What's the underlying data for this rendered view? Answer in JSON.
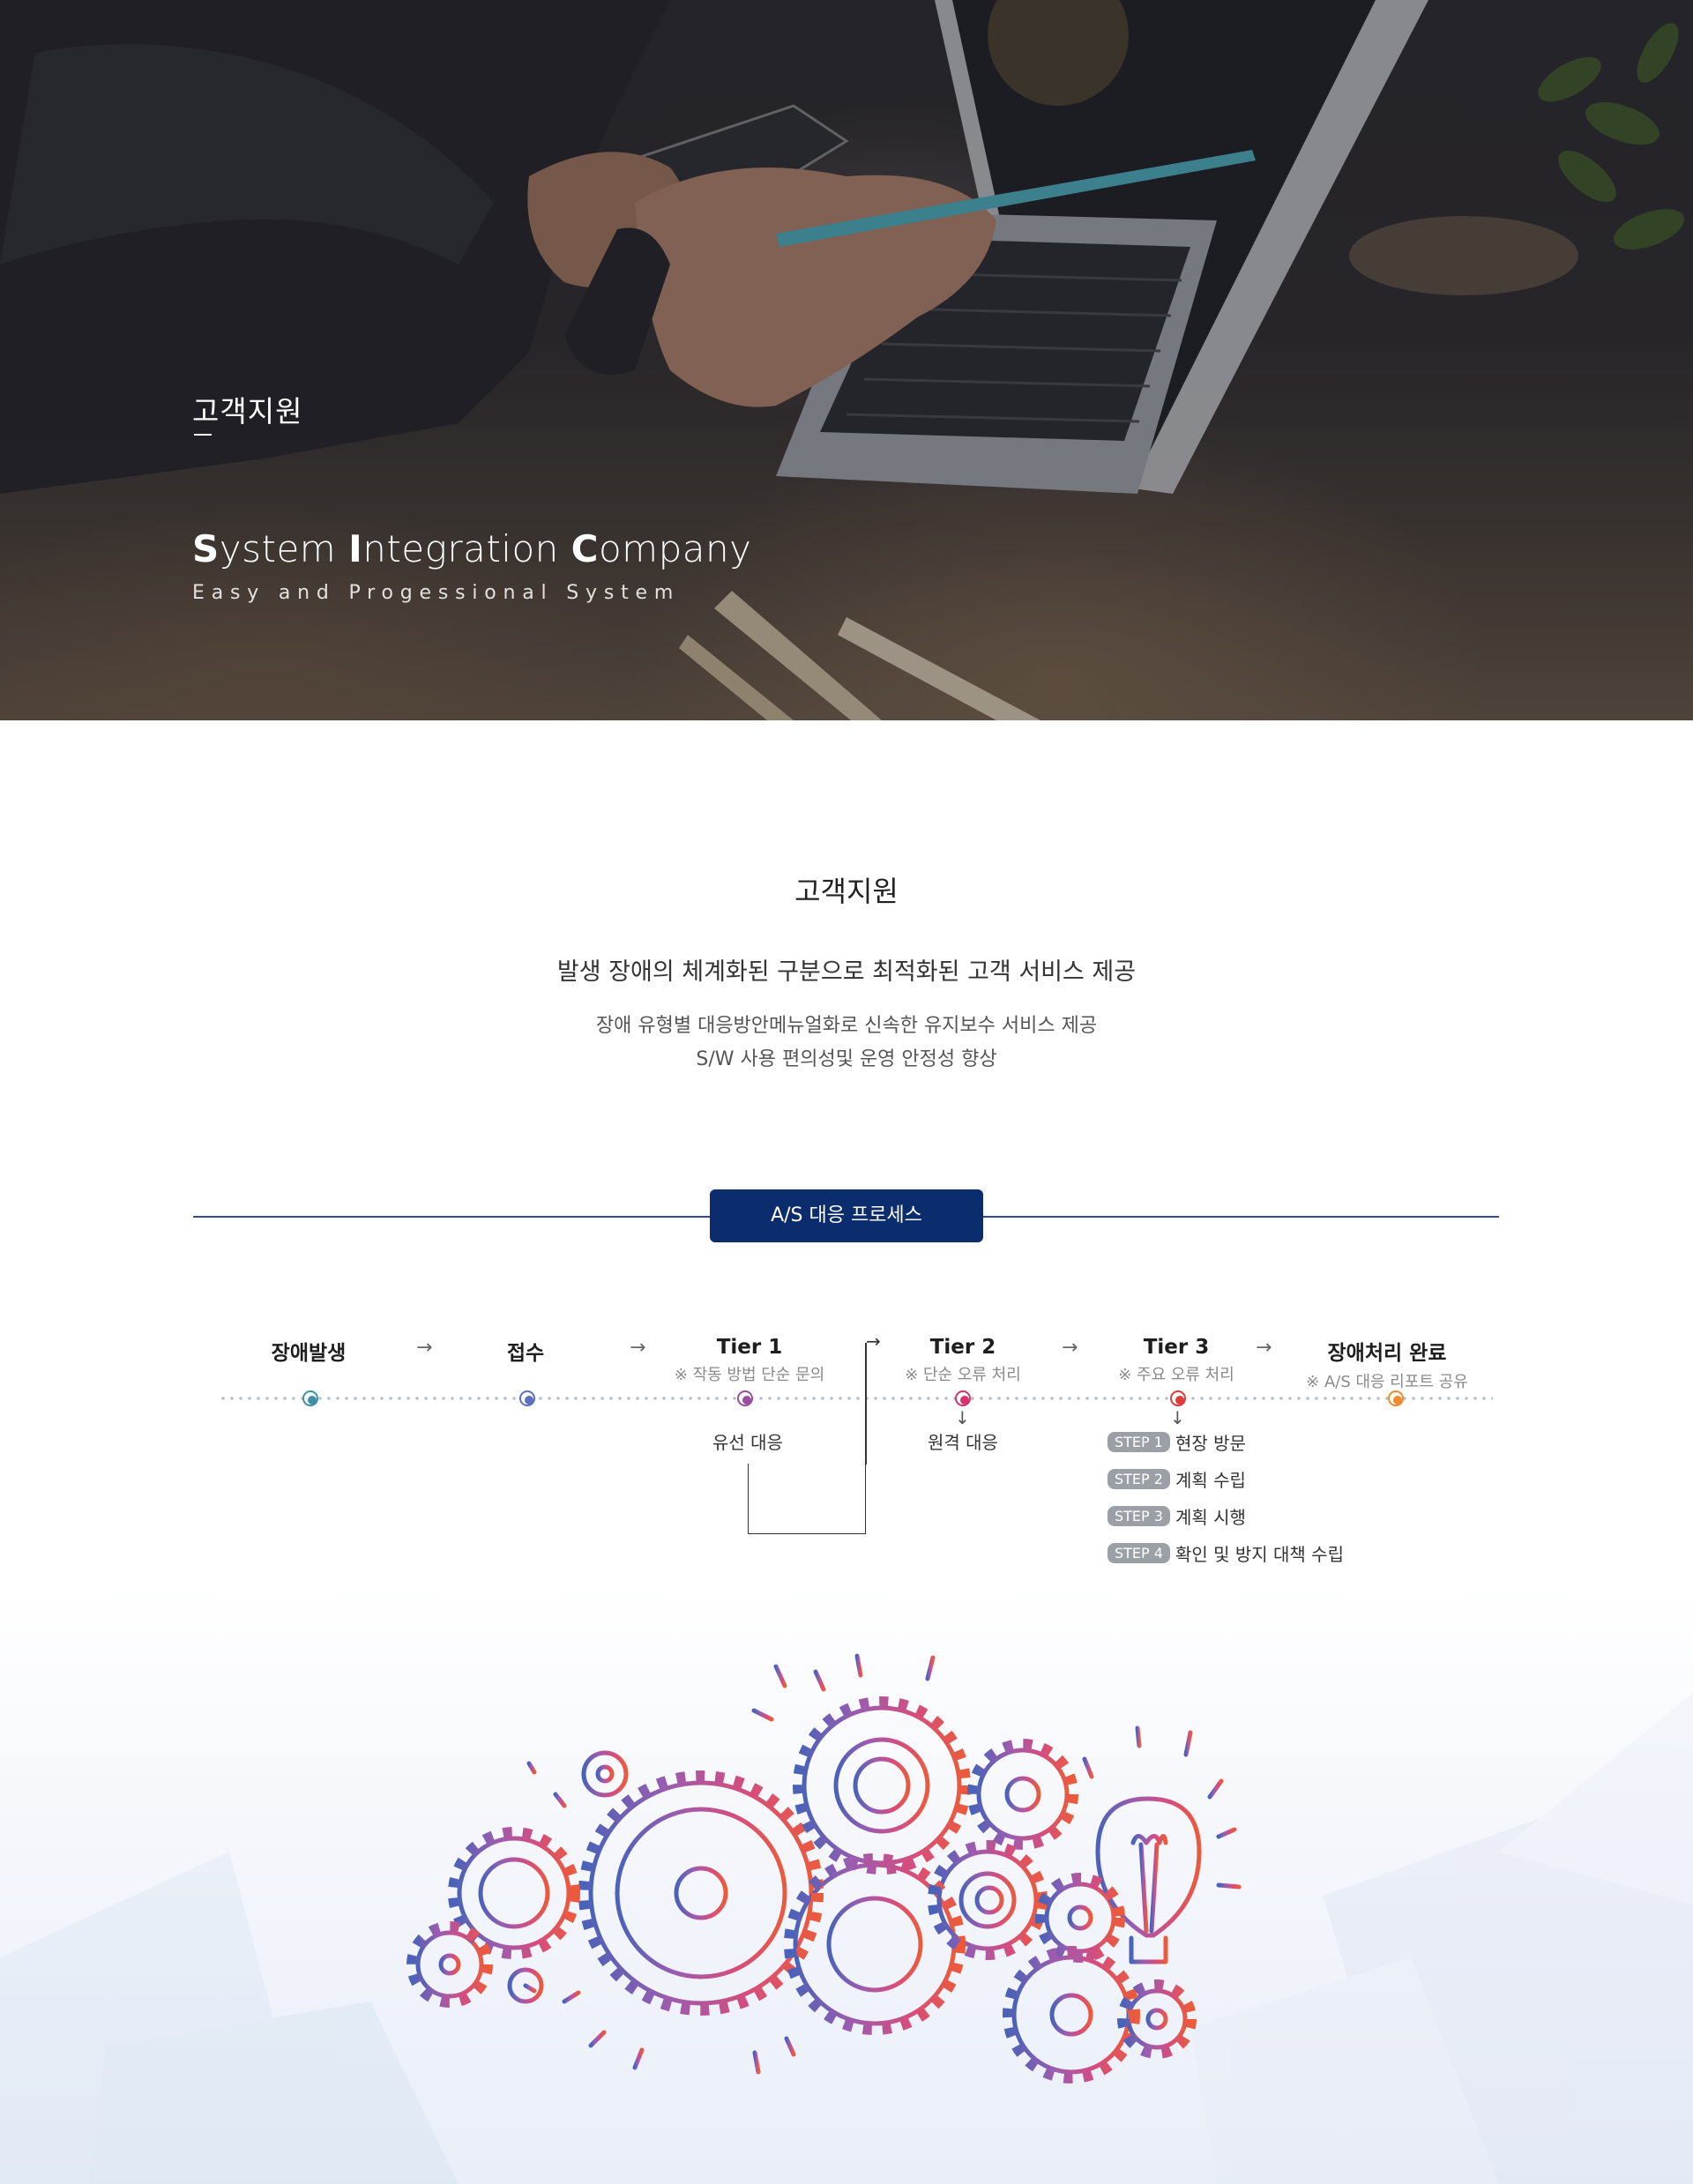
{
  "hero": {
    "title": "고객지원",
    "company_parts": [
      {
        "initial": "S",
        "rest": "ystem "
      },
      {
        "initial": "I",
        "rest": "ntegration "
      },
      {
        "initial": "C",
        "rest": "ompany"
      }
    ],
    "subtitle": "Easy and Progessional System"
  },
  "intro": {
    "title": "고객지원",
    "headline": "발생 장애의 체계화된 구분으로 최적화된 고객 서비스 제공",
    "lines": [
      "장애 유형별 대응방안메뉴얼화로 신속한 유지보수 서비스 제공",
      "S/W 사용 편의성및 운영 안정성 향상"
    ]
  },
  "process": {
    "badge": "A/S 대응 프로세스",
    "stages": [
      {
        "title": "장애발생",
        "note": "",
        "color": "#3d8fa8"
      },
      {
        "title": "접수",
        "note": "",
        "color": "#5a6fc0"
      },
      {
        "title": "Tier 1",
        "note": "※ 작동 방법 단순 문의",
        "color": "#9a4f9e"
      },
      {
        "title": "Tier 2",
        "note": "※ 단순 오류 처리",
        "color": "#d6336c"
      },
      {
        "title": "Tier 3",
        "note": "※ 주요 오류 처리",
        "color": "#e03a3a"
      },
      {
        "title": "장애처리 완료",
        "note": "※ A/S 대응 리포트 공유",
        "color": "#ef8a2e"
      }
    ],
    "arrow": "→",
    "down_arrow": "↓",
    "tier1_action": "유선 대응",
    "tier2_action": "원격 대응",
    "steps": [
      {
        "tag": "STEP 1",
        "text": "현장 방문"
      },
      {
        "tag": "STEP 2",
        "text": "계획 수립"
      },
      {
        "tag": "STEP 3",
        "text": "계획 시행"
      },
      {
        "tag": "STEP 4",
        "text": "확인 및 방지 대책 수립"
      }
    ]
  }
}
